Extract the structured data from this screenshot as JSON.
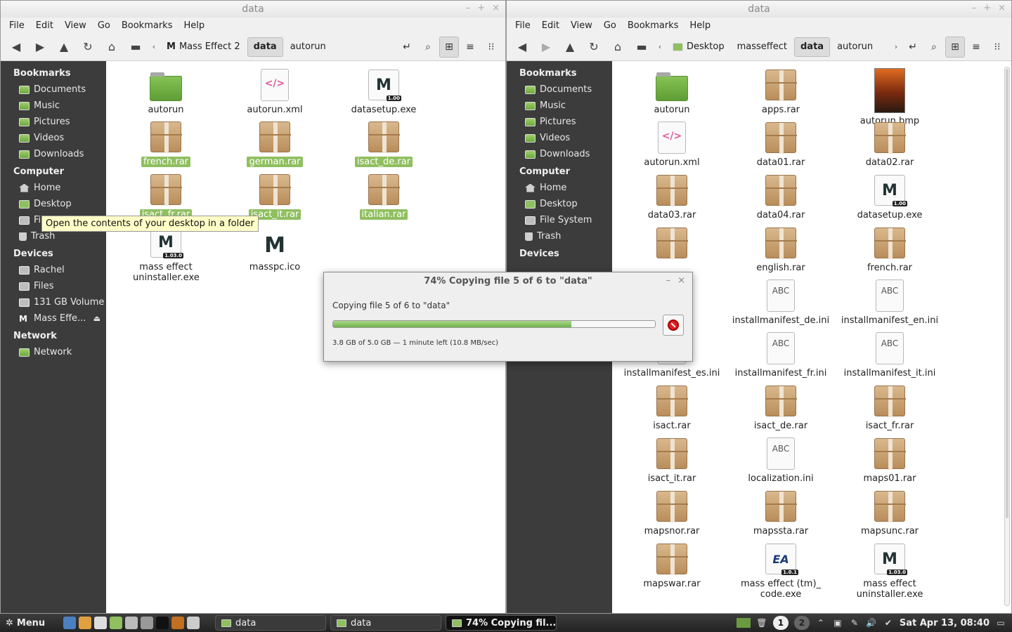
{
  "left": {
    "title": "data",
    "menu": [
      "File",
      "Edit",
      "View",
      "Go",
      "Bookmarks",
      "Help"
    ],
    "path": [
      "Mass Effect 2",
      "data",
      "autorun"
    ],
    "files": [
      {
        "name": "autorun",
        "icon": "folder-icon",
        "selected": false
      },
      {
        "name": "autorun.xml",
        "icon": "xml-file-icon",
        "selected": false
      },
      {
        "name": "datasetup.exe",
        "icon": "mass-effect-exe-icon",
        "selected": false,
        "badge": "1.00"
      },
      {
        "name": "french.rar",
        "icon": "archive-icon",
        "selected": true
      },
      {
        "name": "german.rar",
        "icon": "archive-icon",
        "selected": true
      },
      {
        "name": "isact_de.rar",
        "icon": "archive-icon",
        "selected": true
      },
      {
        "name": "isact_fr.rar",
        "icon": "archive-icon",
        "selected": true
      },
      {
        "name": "isact_it.rar",
        "icon": "archive-icon",
        "selected": true
      },
      {
        "name": "italian.rar",
        "icon": "archive-icon",
        "selected": true
      },
      {
        "name": "mass effect uninstaller.exe",
        "icon": "mass-effect-exe-icon",
        "selected": false,
        "badge": "1.03.0"
      },
      {
        "name": "masspc.ico",
        "icon": "mass-effect-logo-icon",
        "selected": false
      }
    ],
    "tooltip": "Open the contents of your desktop in a folder"
  },
  "right": {
    "title": "data",
    "menu": [
      "File",
      "Edit",
      "View",
      "Go",
      "Bookmarks",
      "Help"
    ],
    "path": [
      "Desktop",
      "masseffect",
      "data",
      "autorun"
    ],
    "files": [
      {
        "name": "autorun",
        "icon": "folder-icon"
      },
      {
        "name": "apps.rar",
        "icon": "archive-icon"
      },
      {
        "name": "autorun.bmp",
        "icon": "image-file-icon"
      },
      {
        "name": "autorun.xml",
        "icon": "xml-file-icon"
      },
      {
        "name": "data01.rar",
        "icon": "archive-icon"
      },
      {
        "name": "data02.rar",
        "icon": "archive-icon"
      },
      {
        "name": "data03.rar",
        "icon": "archive-icon"
      },
      {
        "name": "data04.rar",
        "icon": "archive-icon"
      },
      {
        "name": "datasetup.exe",
        "icon": "mass-effect-exe-icon",
        "badge": "1.00"
      },
      {
        "name": "",
        "icon": "archive-icon"
      },
      {
        "name": "english.rar",
        "icon": "archive-icon"
      },
      {
        "name": "french.rar",
        "icon": "archive-icon"
      },
      {
        "name": "",
        "icon": "ini-file-icon"
      },
      {
        "name": "installmanifest_de.ini",
        "icon": "ini-file-icon",
        "doc_label": "ABC"
      },
      {
        "name": "installmanifest_en.ini",
        "icon": "ini-file-icon",
        "doc_label": "ABC"
      },
      {
        "name": "installmanifest_es.ini",
        "icon": "ini-file-icon"
      },
      {
        "name": "installmanifest_fr.ini",
        "icon": "ini-file-icon",
        "doc_label": "ABC"
      },
      {
        "name": "installmanifest_it.ini",
        "icon": "ini-file-icon",
        "doc_label": "ABC"
      },
      {
        "name": "isact.rar",
        "icon": "archive-icon"
      },
      {
        "name": "isact_de.rar",
        "icon": "archive-icon"
      },
      {
        "name": "isact_fr.rar",
        "icon": "archive-icon"
      },
      {
        "name": "isact_it.rar",
        "icon": "archive-icon"
      },
      {
        "name": "localization.ini",
        "icon": "ini-file-icon",
        "doc_label": "ABC"
      },
      {
        "name": "maps01.rar",
        "icon": "archive-icon"
      },
      {
        "name": "mapsnor.rar",
        "icon": "archive-icon"
      },
      {
        "name": "mapssta.rar",
        "icon": "archive-icon"
      },
      {
        "name": "mapsunc.rar",
        "icon": "archive-icon"
      },
      {
        "name": "mapswar.rar",
        "icon": "archive-icon"
      },
      {
        "name": "mass effect (tm)_ code.exe",
        "icon": "ea-exe-icon",
        "badge": "1.0.1"
      },
      {
        "name": "mass effect uninstaller.exe",
        "icon": "mass-effect-exe-icon",
        "badge": "1.03.0"
      }
    ]
  },
  "sidebar": {
    "bookmarks_label": "Bookmarks",
    "bookmarks": [
      "Documents",
      "Music",
      "Pictures",
      "Videos",
      "Downloads"
    ],
    "computer_label": "Computer",
    "computer_left": [
      "Home",
      "Desktop",
      "Fi",
      "Trash"
    ],
    "computer_right": [
      "Home",
      "Desktop",
      "File System",
      "Trash"
    ],
    "devices_label": "Devices",
    "devices": [
      "Rachel",
      "Files",
      "131 GB Volume",
      "Mass Effe..."
    ],
    "network_label": "Network",
    "network": [
      "Network"
    ]
  },
  "dialog": {
    "title": "74% Copying file 5 of 6 to \"data\"",
    "message": "Copying file 5 of 6 to \"data\"",
    "progress": 0.74,
    "stats": "3.8 GB of 5.0 GB — 1 minute left (10.8 MB/sec)"
  },
  "taskbar": {
    "menu_label": "Menu",
    "tasks": [
      "data",
      "data",
      "74% Copying fil..."
    ],
    "workspaces": [
      "1",
      "2"
    ],
    "clock": "Sat Apr 13, 08:40"
  },
  "colors": {
    "selection": "#8fbf5f",
    "sidebar_bg": "#3c3c3c",
    "progress": "#6fb14a"
  }
}
